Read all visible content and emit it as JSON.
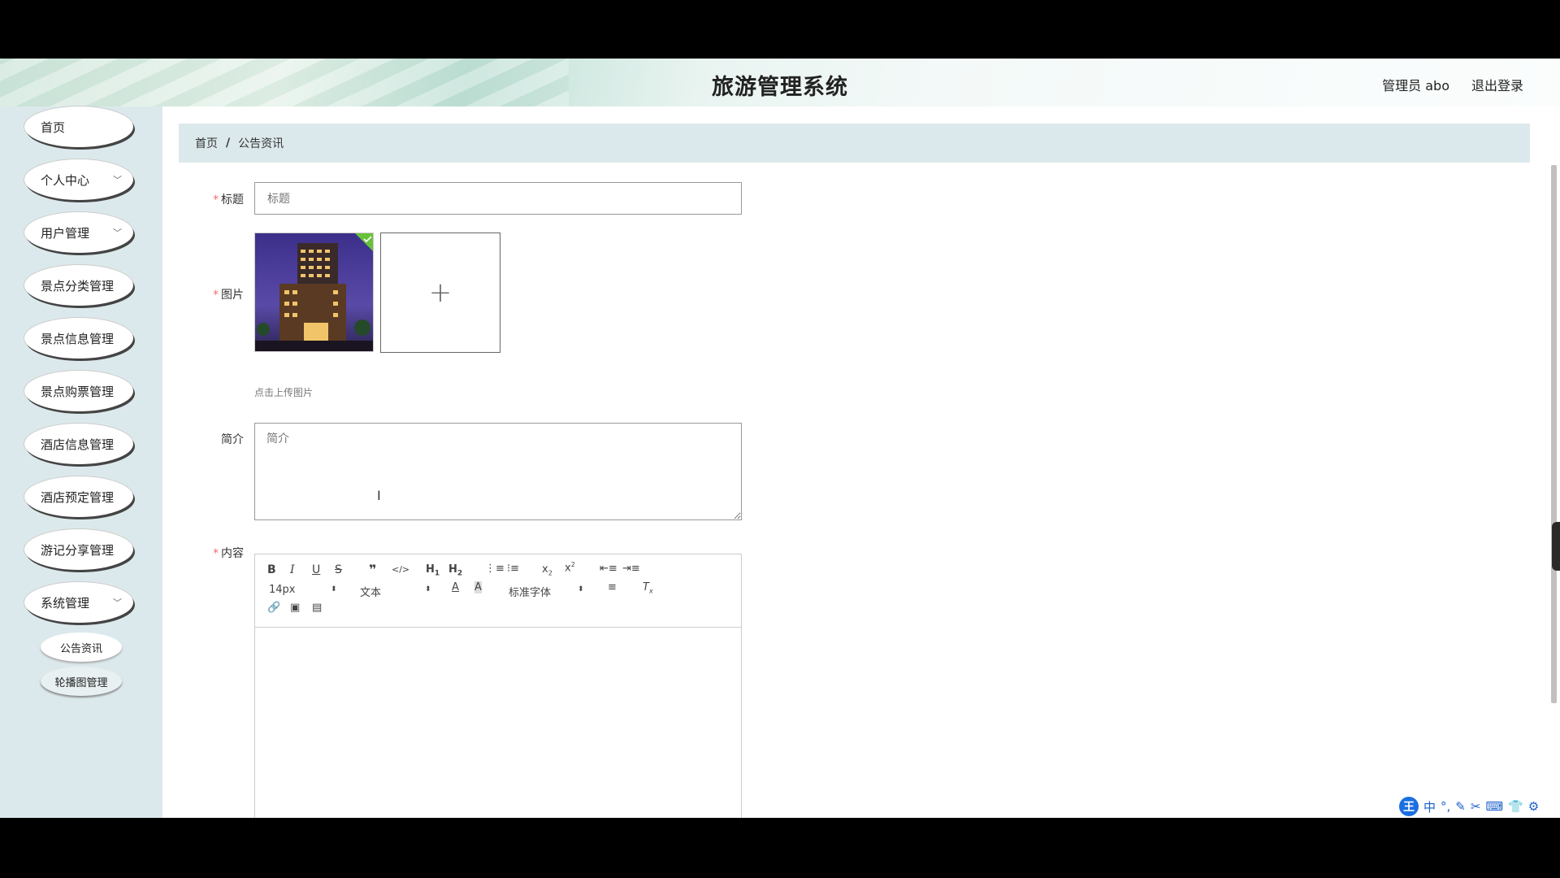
{
  "header": {
    "title": "旅游管理系统",
    "user": "管理员 abo",
    "logout": "退出登录"
  },
  "sidebar": {
    "items": [
      {
        "label": "首页"
      },
      {
        "label": "个人中心"
      },
      {
        "label": "用户管理"
      },
      {
        "label": "景点分类管理"
      },
      {
        "label": "景点信息管理"
      },
      {
        "label": "景点购票管理"
      },
      {
        "label": "酒店信息管理"
      },
      {
        "label": "酒店预定管理"
      },
      {
        "label": "游记分享管理"
      },
      {
        "label": "系统管理"
      }
    ],
    "sub_items": [
      {
        "label": "公告资讯"
      },
      {
        "label": "轮播图管理"
      }
    ]
  },
  "breadcrumb": {
    "home": "首页",
    "sep": "/",
    "current": "公告资讯"
  },
  "form": {
    "title_label": "标题",
    "title_placeholder": "标题",
    "image_label": "图片",
    "upload_hint": "点击上传图片",
    "summary_label": "简介",
    "summary_placeholder": "简介",
    "content_label": "内容"
  },
  "editor": {
    "font_size": "14px",
    "header_select": "文本",
    "font_family": "标准字体"
  },
  "ime": {
    "lang": "中",
    "logo": "王"
  }
}
